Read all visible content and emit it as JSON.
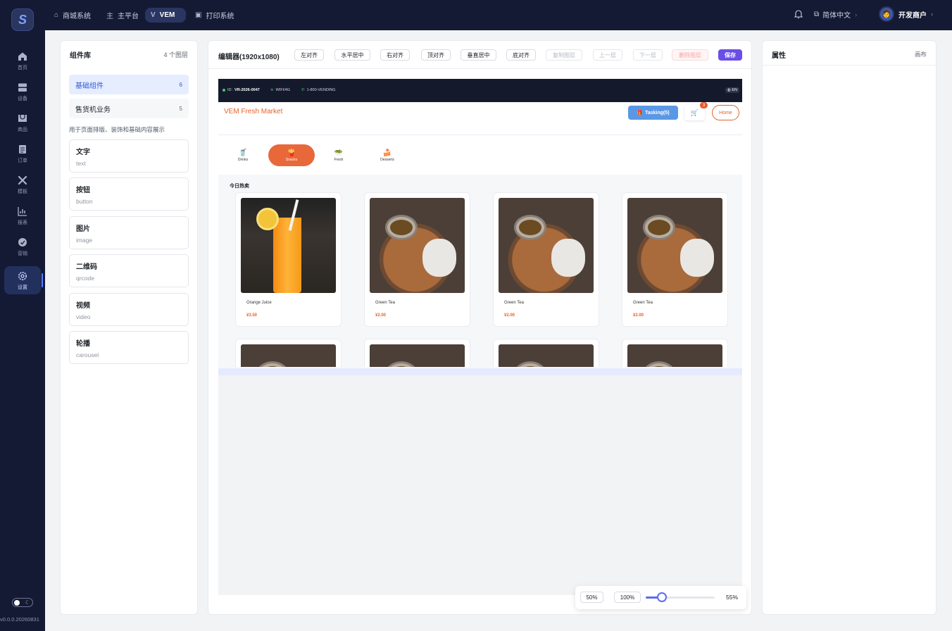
{
  "rail": {
    "logo": "S",
    "items": [
      {
        "label": "首页",
        "icon": "home-icon"
      },
      {
        "label": "设备",
        "icon": "device-icon"
      },
      {
        "label": "商品",
        "icon": "product-icon"
      },
      {
        "label": "订单",
        "icon": "order-icon"
      },
      {
        "label": "模板",
        "icon": "template-icon"
      },
      {
        "label": "报表",
        "icon": "report-icon"
      },
      {
        "label": "营销",
        "icon": "marketing-icon"
      },
      {
        "label": "设置",
        "icon": "settings-icon"
      }
    ],
    "active_index": 7,
    "version": "v0.0.0.20260831"
  },
  "topbar": {
    "tabs": [
      {
        "glyph": "⌂",
        "label": "商城系统"
      },
      {
        "glyph": "主",
        "label": "主平台"
      },
      {
        "glyph": "V",
        "label": "VEM"
      },
      {
        "glyph": "▣",
        "label": "打印系统"
      }
    ],
    "active_tab": 2,
    "language": "简体中文",
    "user": "开发商户"
  },
  "library": {
    "title": "组件库",
    "count": "4 个图层",
    "categories": [
      {
        "label": "基础组件",
        "count": "6"
      },
      {
        "label": "售货机业务",
        "count": "5"
      }
    ],
    "description": "用于页面排版、装饰和基础内容展示",
    "components": [
      {
        "title": "文字",
        "sub": "text"
      },
      {
        "title": "按钮",
        "sub": "button"
      },
      {
        "title": "图片",
        "sub": "image"
      },
      {
        "title": "二维码",
        "sub": "qrcode"
      },
      {
        "title": "视频",
        "sub": "video"
      },
      {
        "title": "轮播",
        "sub": "carousel"
      }
    ]
  },
  "editor": {
    "title": "编辑器(1920x1080)",
    "buttons": [
      "左对齐",
      "水平居中",
      "右对齐",
      "顶对齐",
      "垂直居中",
      "底对齐",
      "复制图层",
      "上一层",
      "下一层",
      "删除图层",
      "保存"
    ]
  },
  "device": {
    "status": {
      "id_label": "ID:",
      "id": "VR-2026-0047",
      "network": "WIFI/4G",
      "phone": "1-800-VENDING",
      "lang": "EN"
    },
    "brand": "VEM Fresh Market",
    "task_button": "Tasking(5)",
    "cart_count": "3",
    "home_button": "Home",
    "categories": [
      {
        "emoji": "🥤",
        "label": "Drinks"
      },
      {
        "emoji": "🍟",
        "label": "Snacks"
      },
      {
        "emoji": "🥗",
        "label": "Fresh"
      },
      {
        "emoji": "🍰",
        "label": "Desserts"
      }
    ],
    "active_category": 1,
    "hot_title": "今日热卖",
    "products": [
      {
        "name": "Orange Juice",
        "price": "¥3.50",
        "image": "orange-juice"
      },
      {
        "name": "Green Tea",
        "price": "¥2.00",
        "image": "green-tea"
      },
      {
        "name": "Green Tea",
        "price": "¥2.00",
        "image": "green-tea"
      },
      {
        "name": "Green Tea",
        "price": "¥2.00",
        "image": "green-tea"
      }
    ]
  },
  "zoom": {
    "preset_a": "50%",
    "preset_b": "100%",
    "value": "55%",
    "level_percent": 55,
    "range": [
      10,
      200
    ]
  },
  "properties": {
    "title": "属性",
    "tab": "画布"
  },
  "colors": {
    "accent": "#6a4ee6",
    "brand_orange": "#e5622a",
    "sidebar": "#141a33",
    "primary_blue": "#2e58d6"
  }
}
